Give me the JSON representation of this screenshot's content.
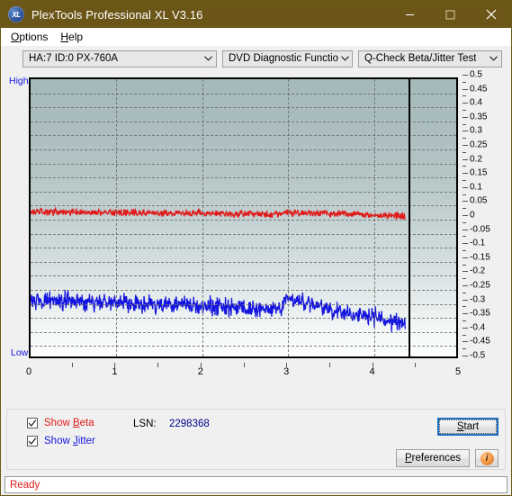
{
  "window": {
    "title": "PlexTools Professional XL V3.16",
    "icon": "XL",
    "icon_name": "plextools-logo-icon",
    "minimize_label": "minimize-icon",
    "maximize_label": "maximize-icon",
    "close_label": "close-icon",
    "titlebar_color": "#6b5617"
  },
  "menubar": {
    "items": [
      {
        "label": "Options",
        "mnemonic": "O"
      },
      {
        "label": "Help",
        "mnemonic": "H"
      }
    ]
  },
  "toolbar": {
    "drive": {
      "value": "HA:7 ID:0  PX-760A"
    },
    "function": {
      "value": "DVD Diagnostic Functions"
    },
    "test": {
      "value": "Q-Check Beta/Jitter Test"
    }
  },
  "chart_data": {
    "type": "line",
    "title": "",
    "xlabel": "",
    "ylabel": "",
    "xlim": [
      0,
      5
    ],
    "ylim": [
      -0.5,
      0.5
    ],
    "grid": true,
    "legend": "checkbox-toggles",
    "axis_annotations": {
      "top_left": "High",
      "bottom_left": "Low"
    },
    "x_ticks": [
      "0",
      "1",
      "2",
      "3",
      "4",
      "5"
    ],
    "y_ticks": [
      "0.5",
      "0.45",
      "0.4",
      "0.35",
      "0.3",
      "0.25",
      "0.2",
      "0.15",
      "0.1",
      "0.05",
      "0",
      "-0.05",
      "-0.1",
      "-0.15",
      "-0.2",
      "-0.25",
      "-0.3",
      "-0.35",
      "-0.4",
      "-0.45",
      "-0.5"
    ],
    "cursor_x": 4.4,
    "data_end_x": 4.4,
    "series": [
      {
        "name": "Beta",
        "color": "#e01b1b",
        "x": [
          0.0,
          0.18,
          0.37,
          0.55,
          0.73,
          0.92,
          1.1,
          1.28,
          1.47,
          1.65,
          1.83,
          2.02,
          2.2,
          2.38,
          2.57,
          2.75,
          2.93,
          3.0,
          3.12,
          3.3,
          3.48,
          3.67,
          3.85,
          4.03,
          4.22,
          4.4
        ],
        "y": [
          0.022,
          0.021,
          0.021,
          0.02,
          0.02,
          0.019,
          0.019,
          0.018,
          0.018,
          0.017,
          0.017,
          0.016,
          0.015,
          0.015,
          0.014,
          0.013,
          0.012,
          0.02,
          0.019,
          0.018,
          0.016,
          0.014,
          0.012,
          0.01,
          0.01,
          0.003
        ],
        "noise": 0.012
      },
      {
        "name": "Jitter",
        "color": "#1515e0",
        "x": [
          0.0,
          0.18,
          0.37,
          0.55,
          0.73,
          0.92,
          1.1,
          1.28,
          1.47,
          1.65,
          1.83,
          2.02,
          2.2,
          2.38,
          2.57,
          2.75,
          2.93,
          3.0,
          3.12,
          3.3,
          3.48,
          3.67,
          3.85,
          4.03,
          4.22,
          4.4
        ],
        "y": [
          -0.3,
          -0.3,
          -0.302,
          -0.303,
          -0.305,
          -0.307,
          -0.308,
          -0.31,
          -0.312,
          -0.315,
          -0.318,
          -0.32,
          -0.322,
          -0.325,
          -0.328,
          -0.331,
          -0.334,
          -0.292,
          -0.298,
          -0.312,
          -0.33,
          -0.345,
          -0.352,
          -0.356,
          -0.372,
          -0.382
        ],
        "noise": 0.03
      }
    ]
  },
  "controls": {
    "show_beta": {
      "label": "Show Beta",
      "mnemonic": "B",
      "checked": true
    },
    "show_jitter": {
      "label": "Show Jitter",
      "mnemonic": "J",
      "checked": true
    },
    "lsn_label": "LSN:",
    "lsn_value": "2298368",
    "start_button": {
      "label": "Start",
      "mnemonic": "S"
    },
    "preferences_button": {
      "label": "Preferences",
      "mnemonic": "P"
    },
    "info_button": {
      "label": "i"
    }
  },
  "statusbar": {
    "text": "Ready"
  }
}
